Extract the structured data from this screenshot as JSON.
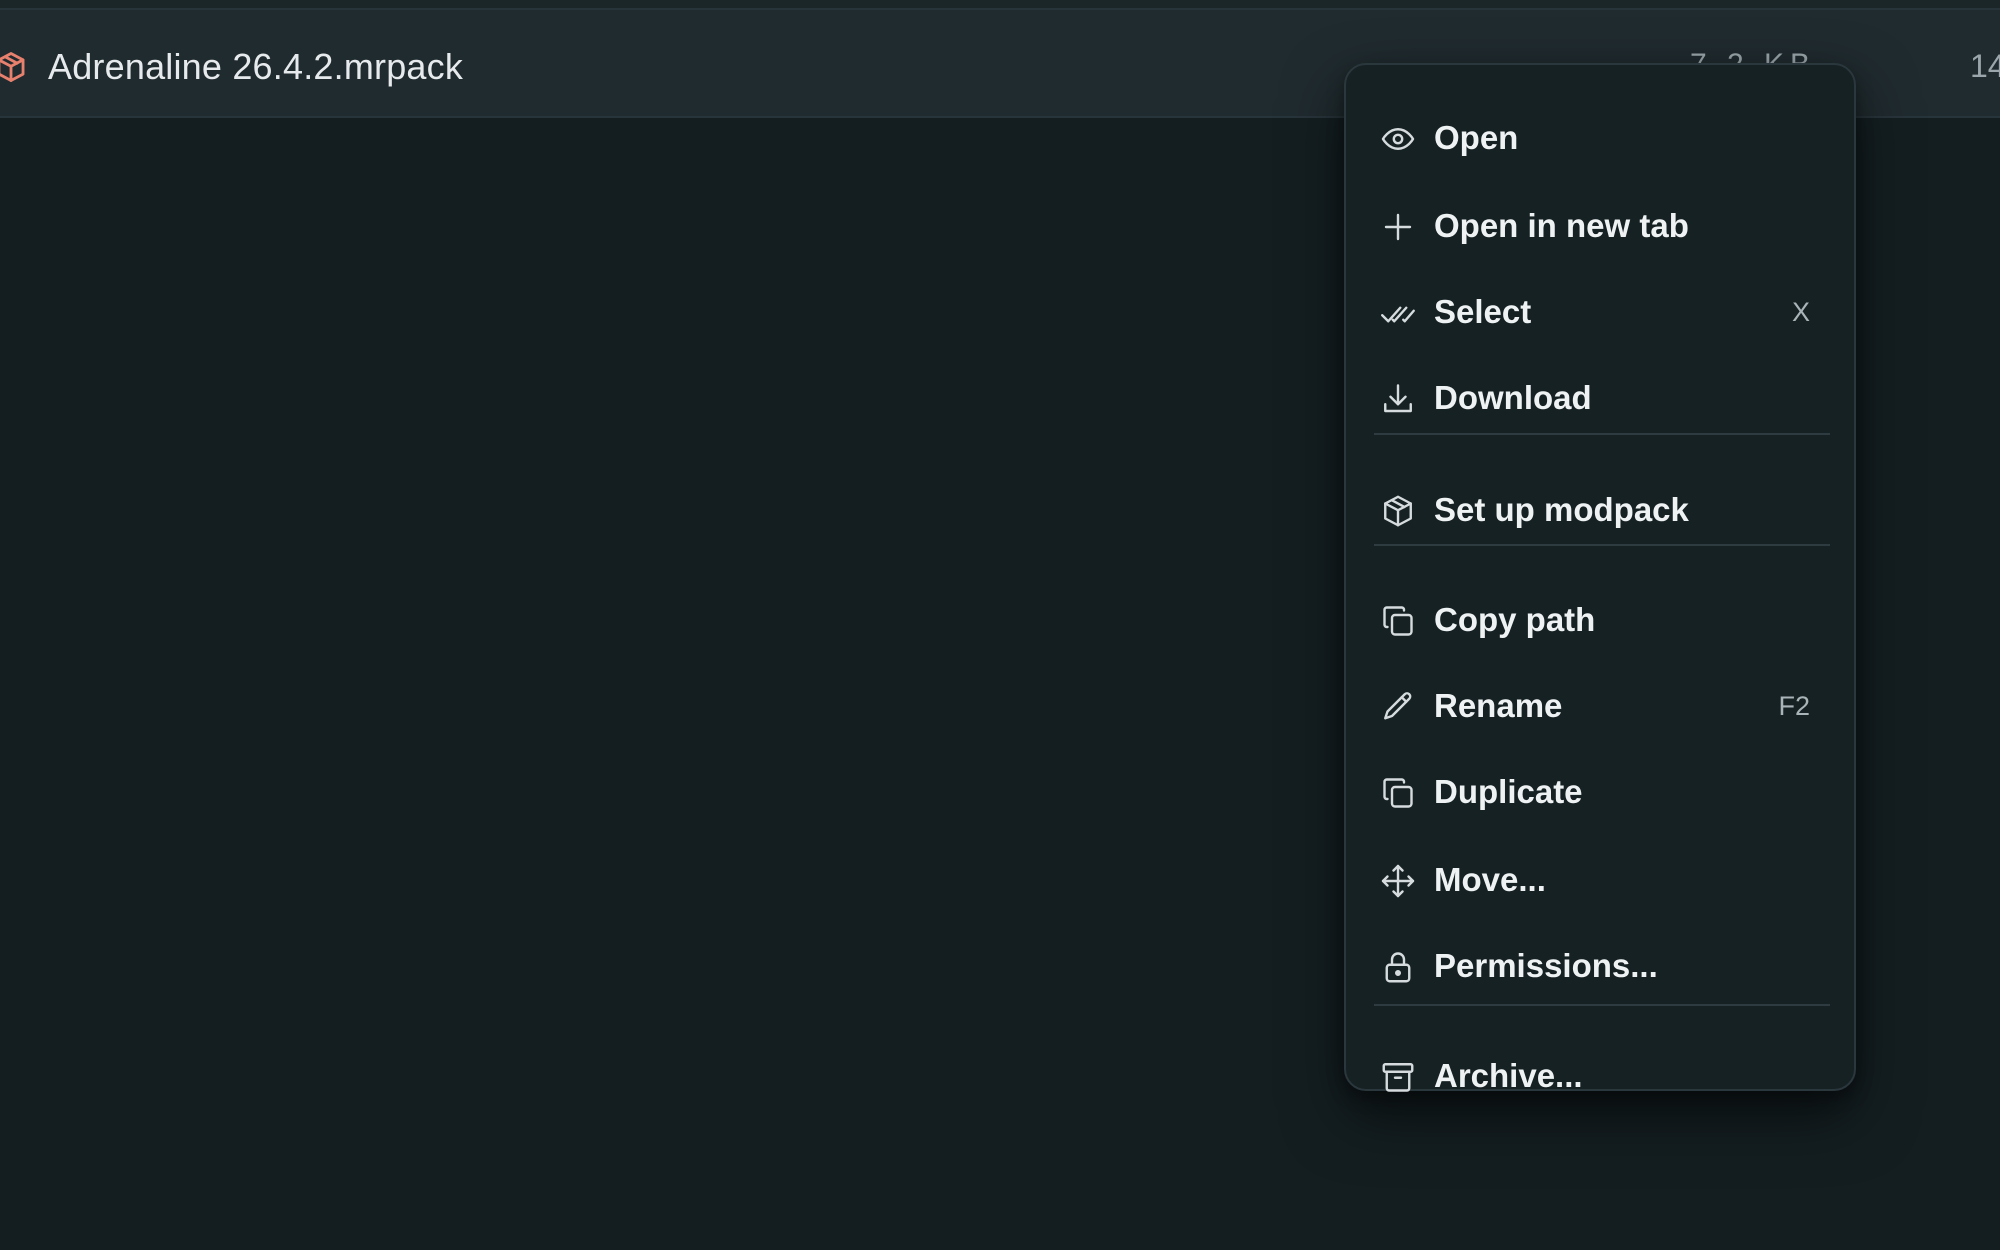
{
  "file_row": {
    "name": "Adrenaline 26.4.2.mrpack",
    "size": "7.2 KB",
    "date": "14"
  },
  "menu": {
    "open": {
      "label": "Open",
      "icon": "eye-icon"
    },
    "open_new_tab": {
      "label": "Open in new tab",
      "icon": "plus-icon"
    },
    "select": {
      "label": "Select",
      "shortcut": "X",
      "icon": "double-check-icon"
    },
    "download": {
      "label": "Download",
      "icon": "download-icon"
    },
    "setup_modpack": {
      "label": "Set up modpack",
      "icon": "package-icon"
    },
    "copy_path": {
      "label": "Copy path",
      "icon": "copy-icon"
    },
    "rename": {
      "label": "Rename",
      "shortcut": "F2",
      "icon": "pencil-icon"
    },
    "duplicate": {
      "label": "Duplicate",
      "icon": "copy-icon"
    },
    "move": {
      "label": "Move...",
      "icon": "move-icon"
    },
    "permissions": {
      "label": "Permissions...",
      "icon": "lock-icon"
    },
    "archive": {
      "label": "Archive...",
      "icon": "archive-icon"
    }
  },
  "colors": {
    "background": "#141e21",
    "row_background": "#202b2f",
    "menu_background": "#162124",
    "file_icon": "#e8806e",
    "text": "#eef2f3",
    "muted": "#a9b4b8"
  }
}
